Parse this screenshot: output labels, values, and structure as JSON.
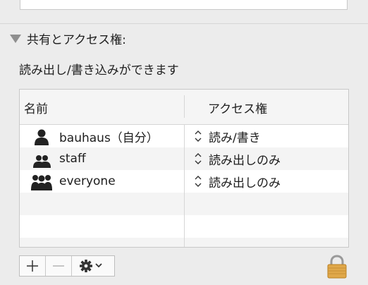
{
  "section": {
    "title": "共有とアクセス権:",
    "status_text": "読み出し/書き込みができます"
  },
  "table": {
    "columns": {
      "name": "名前",
      "access": "アクセス権"
    },
    "rows": [
      {
        "name": "bauhaus（自分）",
        "access": "読み/書き",
        "icon": "single-user-icon"
      },
      {
        "name": "staff",
        "access": "読み出しのみ",
        "icon": "group-icon"
      },
      {
        "name": "everyone",
        "access": "読み出しのみ",
        "icon": "everyone-icon"
      }
    ]
  },
  "toolbar": {
    "add_symbol": "+",
    "remove_symbol": "−",
    "gear_icon": "gear-icon",
    "lock_icon": "lock-icon"
  },
  "colors": {
    "background": "#ececec",
    "table_background": "#ffffff",
    "alt_row": "#f4f4f4",
    "border": "#c8c8c8",
    "lock_gold": "#e0a84a"
  }
}
